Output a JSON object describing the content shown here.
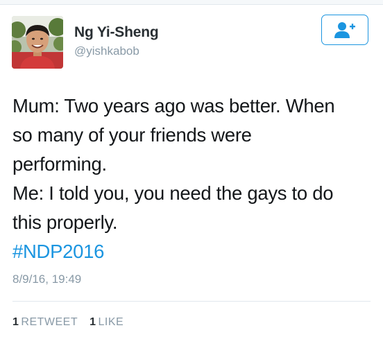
{
  "user": {
    "display_name": "Ng Yi-Sheng",
    "handle": "@yishkabob"
  },
  "follow_button": {
    "icon": "add-user-icon",
    "color": "#1b95e0"
  },
  "tweet": {
    "lines": [
      "Mum: Two years ago was better. When",
      "so many of your friends were",
      "performing.",
      "Me: I told you, you need the gays to do",
      "this properly."
    ],
    "hashtag": "#NDP2016",
    "timestamp": "8/9/16, 19:49"
  },
  "stats": {
    "retweet_count": "1",
    "retweet_label": "RETWEET",
    "like_count": "1",
    "like_label": "LIKE"
  },
  "colors": {
    "accent": "#1b95e0",
    "muted": "#8899a6",
    "text": "#14171a"
  }
}
